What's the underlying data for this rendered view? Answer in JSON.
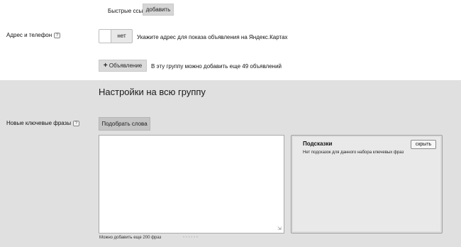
{
  "quick_links": {
    "label": "Быстрые ссылки",
    "add_button": "добавить"
  },
  "address_phone": {
    "label": "Адрес и телефон",
    "help_icon": "?",
    "toggle_label": "нет",
    "description": "Укажите адрес для показа объявления на Яндекс.Картах"
  },
  "ads": {
    "add_button_icon": "+",
    "add_button_label": "Объявление",
    "note": "В эту группу можно добавить еще 49 объявлений"
  },
  "group_settings": {
    "title": "Настройки на всю группу",
    "new_keyphrases_label": "Новые ключевые фразы",
    "help_icon": "?",
    "pick_words_button": "Подобрать слова",
    "textarea_value": "",
    "footnote": "Можно добавить еще 200 фраз",
    "faint_links": "• • •  • • •"
  },
  "hints": {
    "title": "Подсказки",
    "hide_button": "скрыть",
    "text": "Нет подсказок для данного набора ключевых фраз"
  },
  "colors": {
    "top_background": "#ffffff",
    "bottom_background": "#e0e0e0",
    "button_gray": "#d6d6d6"
  },
  "icons": [
    "help-icon",
    "plus-icon",
    "resize-grip-icon"
  ]
}
